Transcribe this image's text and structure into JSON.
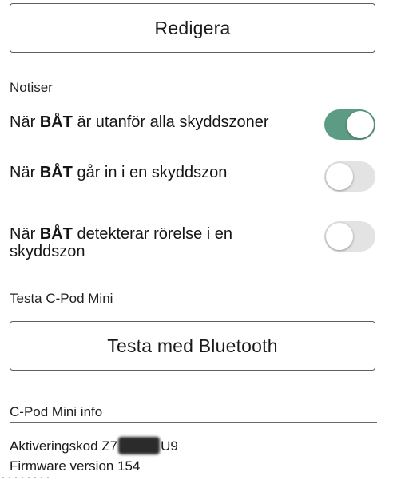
{
  "edit_button": {
    "label": "Redigera"
  },
  "notifications": {
    "section_label": "Notiser",
    "items": [
      {
        "prefix": "När ",
        "bold": "BÅT",
        "suffix": " är utanför alla skyddszoner",
        "enabled": true
      },
      {
        "prefix": "När ",
        "bold": "BÅT",
        "suffix": " går in i en skyddszon",
        "enabled": false
      },
      {
        "prefix": "När ",
        "bold": "BÅT",
        "suffix": " detekterar rörelse i en skyddszon",
        "enabled": false
      }
    ]
  },
  "test": {
    "section_label": "Testa C-Pod Mini",
    "button_label": "Testa med Bluetooth"
  },
  "info": {
    "section_label": "C-Pod Mini info",
    "activation_prefix": "Aktiveringskod Z7",
    "activation_suffix": "U9",
    "firmware": "Firmware version 154"
  },
  "colors": {
    "toggle_on": "#5d9c84",
    "toggle_off": "#e3e3e3"
  }
}
